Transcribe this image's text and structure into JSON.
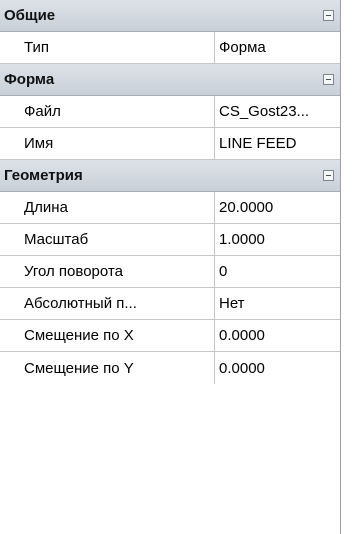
{
  "sections": [
    {
      "title": "Общие",
      "rows": [
        {
          "name": "Тип",
          "value": "Форма"
        }
      ]
    },
    {
      "title": "Форма",
      "rows": [
        {
          "name": "Файл",
          "value": "CS_Gost23..."
        },
        {
          "name": "Имя",
          "value": "LINE FEED"
        }
      ]
    },
    {
      "title": "Геометрия",
      "rows": [
        {
          "name": "Длина",
          "value": "20.0000"
        },
        {
          "name": "Масштаб",
          "value": "1.0000"
        },
        {
          "name": "Угол поворота",
          "value": "0"
        },
        {
          "name": "Абсолютный п...",
          "value": "Нет"
        },
        {
          "name": "Смещение по X",
          "value": "0.0000"
        },
        {
          "name": "Смещение по Y",
          "value": "0.0000"
        }
      ]
    }
  ]
}
